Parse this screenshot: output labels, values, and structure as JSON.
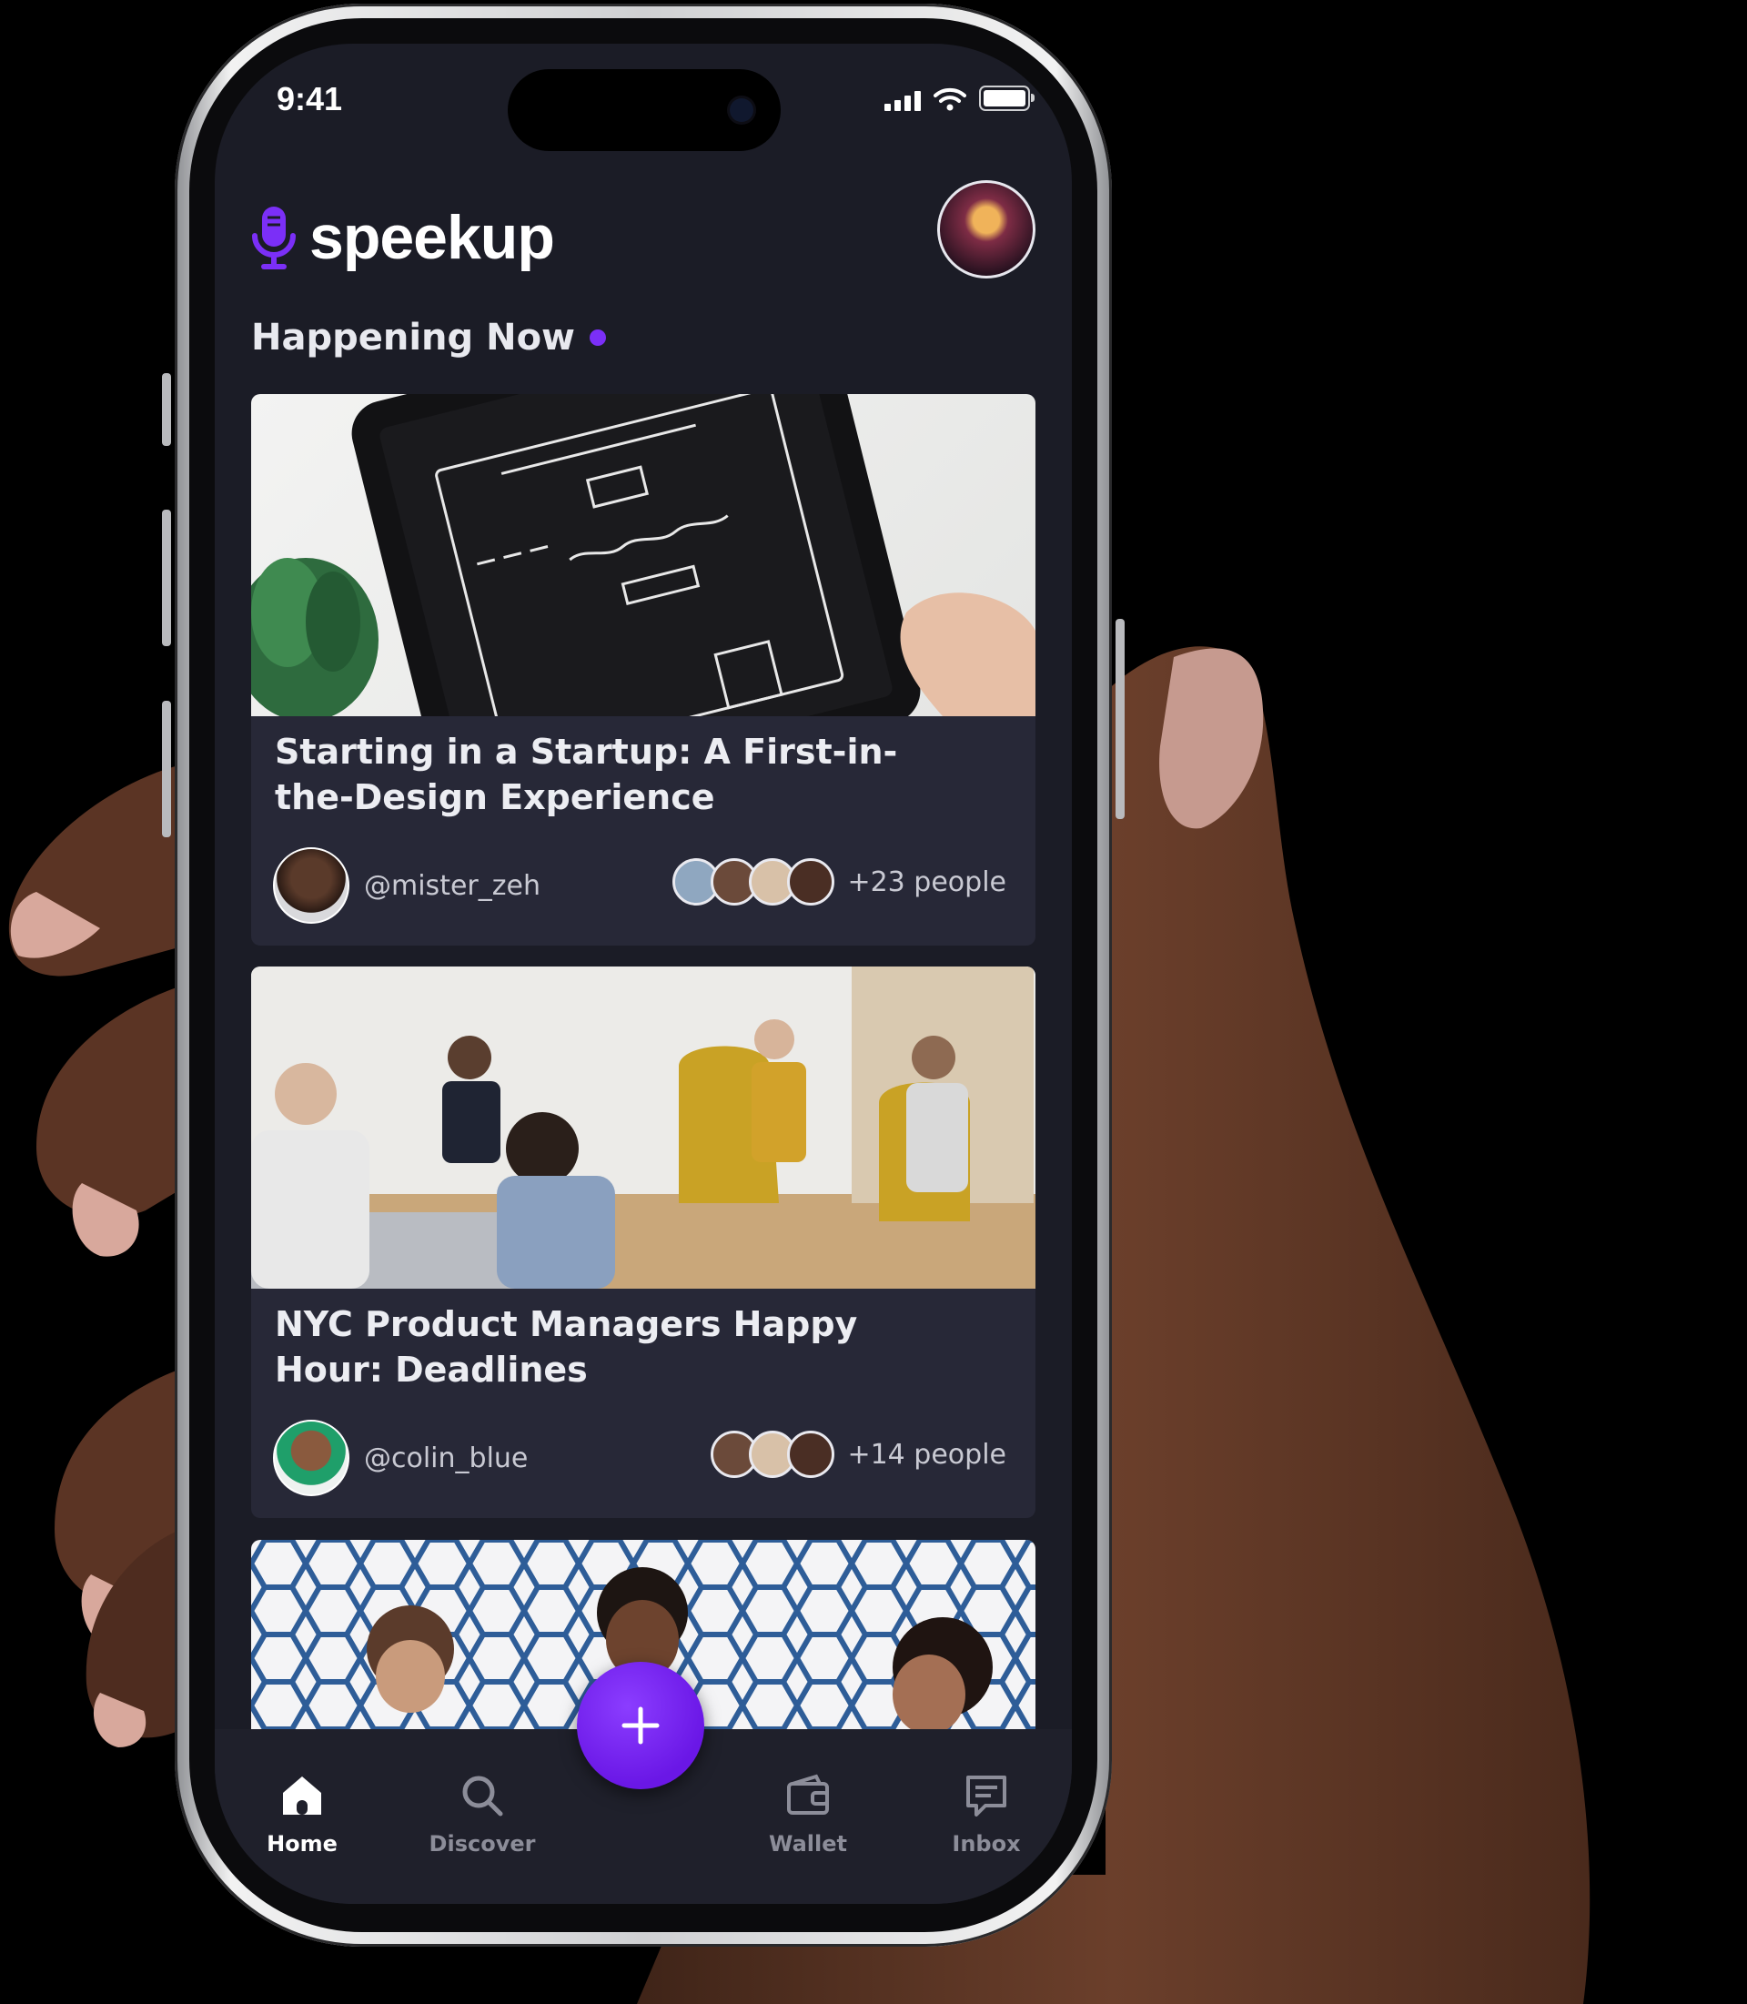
{
  "status_bar": {
    "time": "9:41"
  },
  "app": {
    "name": "speekup",
    "brand_color": "#7b2ff7"
  },
  "feed": {
    "section_title": "Happening Now",
    "cards": [
      {
        "title": "Starting in a Startup: A First-in-the-Design Experience",
        "host": "@mister_zeh",
        "attendees": "+23 people"
      },
      {
        "title": "NYC Product Managers Happy Hour: Deadlines",
        "host": "@colin_blue",
        "attendees": "+14 people"
      }
    ]
  },
  "tabs": [
    {
      "label": "Home",
      "icon": "home-icon",
      "active": true
    },
    {
      "label": "Discover",
      "icon": "search-icon",
      "active": false
    },
    {
      "label": "Wallet",
      "icon": "wallet-icon",
      "active": false
    },
    {
      "label": "Inbox",
      "icon": "inbox-icon",
      "active": false
    }
  ],
  "fab": {
    "icon": "plus-icon"
  }
}
